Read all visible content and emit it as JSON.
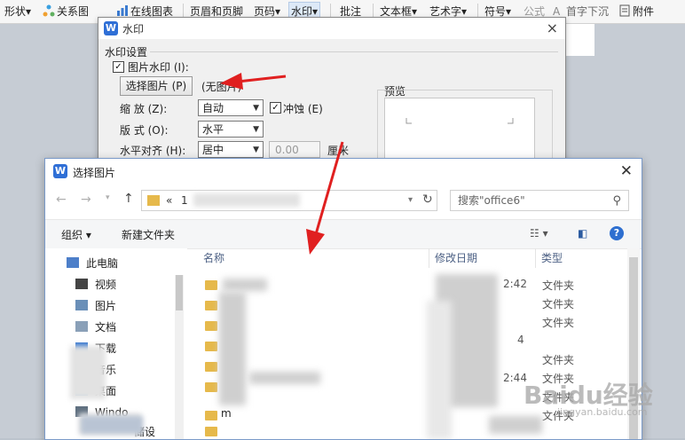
{
  "ribbon": {
    "items": [
      "形状",
      "关系图",
      "在线图表",
      "页眉和页脚",
      "页码",
      "水印",
      "批注",
      "文本框",
      "艺术字",
      "符号",
      "公式",
      "首字下沉",
      "附件"
    ],
    "dropdown_marker": "▾"
  },
  "watermark_dialog": {
    "title": "水印",
    "close": "×",
    "section_label": "水印设置",
    "picture_watermark_label": "图片水印 (I):",
    "picture_watermark_checked": true,
    "choose_picture_button": "选择图片 (P)",
    "picture_status": "(无图片)",
    "scale_label": "缩    放 (Z):",
    "scale_value": "自动",
    "washout_label": "冲蚀 (E)",
    "washout_checked": true,
    "layout_label": "版    式 (O):",
    "layout_value": "水平",
    "halign_label": "水平对齐 (H):",
    "halign_value": "居中",
    "offset_value": "0.00",
    "unit_label": "厘米",
    "preview_label": "预览"
  },
  "file_dialog": {
    "title": "选择图片",
    "close": "✕",
    "path_prefix": "«",
    "path_segment": "1",
    "search_placeholder": "搜索\"office6\"",
    "organize_button": "组织",
    "new_folder_button": "新建文件夹",
    "sidebar": {
      "items": [
        "此电脑",
        "视频",
        "图片",
        "文档",
        "下载",
        "音乐",
        "桌面",
        "Windo",
        "储设"
      ]
    },
    "columns": {
      "name": "名称",
      "modified": "修改日期",
      "type": "类型"
    },
    "rows": [
      {
        "type": "文件夹",
        "date_fragment": "2:42"
      },
      {
        "type": "文件夹",
        "date_fragment": ""
      },
      {
        "type": "文件夹",
        "date_fragment": "4"
      },
      {
        "type": "文件夹",
        "date_fragment": "2:44"
      },
      {
        "type": "文件夹",
        "date_fragment": ""
      },
      {
        "type": "文件夹",
        "date_fragment": ""
      },
      {
        "type": "文件夹",
        "date_fragment": ""
      }
    ],
    "partial_row_name": "m"
  },
  "site_watermark": {
    "brand": "Baidu经验",
    "url": "jingyan.baidu.com"
  },
  "colors": {
    "accent_blue": "#2f6fd6",
    "arrow_red": "#e02020",
    "folder_yellow": "#e6b94b"
  }
}
